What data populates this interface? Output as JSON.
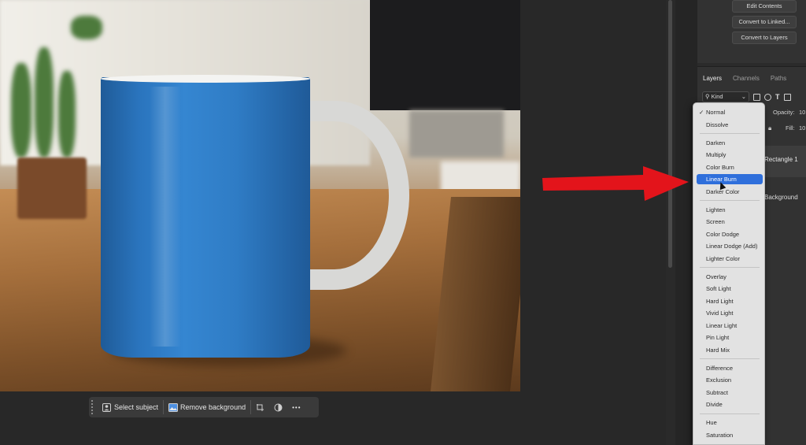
{
  "taskbar": {
    "select_subject": "Select subject",
    "remove_background": "Remove background",
    "icons": [
      "person-icon",
      "image-icon",
      "transform-icon",
      "contrast-icon",
      "more-icon"
    ],
    "more": "•••"
  },
  "properties": {
    "buttons": [
      "Edit Contents",
      "Convert to Linked...",
      "Convert to Layers"
    ]
  },
  "layers_panel": {
    "tabs": [
      "Layers",
      "Channels",
      "Paths"
    ],
    "kind_filter": "Kind",
    "opacity_label": "Opacity:",
    "opacity_value": "10",
    "fill_label": "Fill:",
    "fill_value": "10",
    "layers": [
      "Rectangle 1",
      "Background"
    ]
  },
  "blend_menu": {
    "selected": "Linear Burn",
    "checked": "Normal",
    "groups": [
      [
        "Normal",
        "Dissolve"
      ],
      [
        "Darken",
        "Multiply",
        "Color Burn",
        "Linear Burn",
        "Darker Color"
      ],
      [
        "Lighten",
        "Screen",
        "Color Dodge",
        "Linear Dodge (Add)",
        "Lighter Color"
      ],
      [
        "Overlay",
        "Soft Light",
        "Hard Light",
        "Vivid Light",
        "Linear Light",
        "Pin Light",
        "Hard Mix"
      ],
      [
        "Difference",
        "Exclusion",
        "Subtract",
        "Divide"
      ],
      [
        "Hue",
        "Saturation"
      ]
    ]
  },
  "colors": {
    "accent_selected": "#2f6fdb",
    "annotation_arrow": "#e3141b",
    "mug_blue": "#2a74bd"
  }
}
